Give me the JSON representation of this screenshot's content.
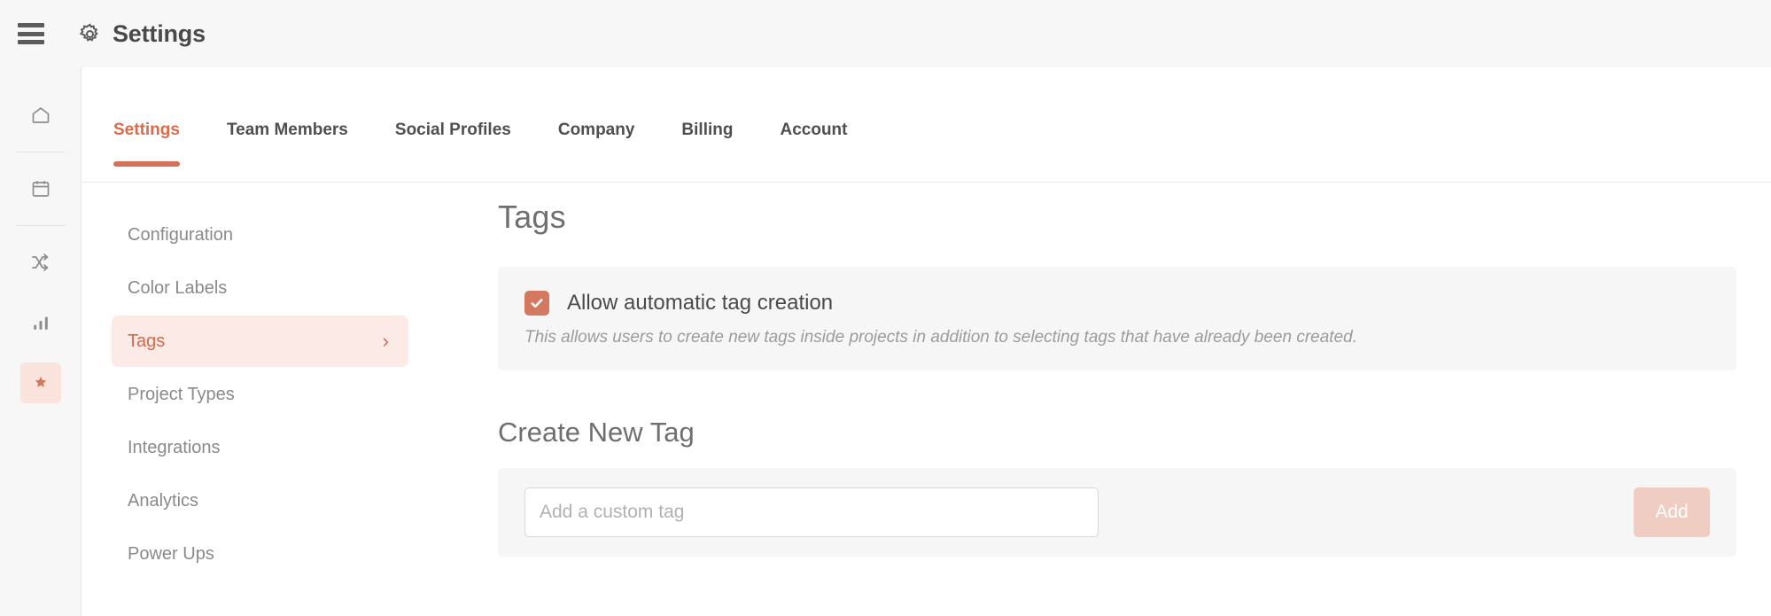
{
  "header": {
    "menu_icon": "hamburger-icon",
    "gear_icon": "gear-icon",
    "title": "Settings"
  },
  "rail": {
    "items": [
      {
        "icon": "home-icon",
        "highlight": false
      },
      {
        "icon": "calendar-icon",
        "highlight": false
      },
      {
        "icon": "shuffle-icon",
        "highlight": false
      },
      {
        "icon": "bar-chart-icon",
        "highlight": false
      },
      {
        "icon": "star-bookmark-icon",
        "highlight": true
      }
    ]
  },
  "tabs": [
    {
      "label": "Settings",
      "active": true
    },
    {
      "label": "Team Members",
      "active": false
    },
    {
      "label": "Social Profiles",
      "active": false
    },
    {
      "label": "Company",
      "active": false
    },
    {
      "label": "Billing",
      "active": false
    },
    {
      "label": "Account",
      "active": false
    }
  ],
  "submenu": [
    {
      "label": "Configuration",
      "active": false
    },
    {
      "label": "Color Labels",
      "active": false
    },
    {
      "label": "Tags",
      "active": true,
      "chevron": "›"
    },
    {
      "label": "Project Types",
      "active": false
    },
    {
      "label": "Integrations",
      "active": false
    },
    {
      "label": "Analytics",
      "active": false
    },
    {
      "label": "Power Ups",
      "active": false
    }
  ],
  "main": {
    "title": "Tags",
    "auto_tag": {
      "checked": true,
      "label": "Allow automatic tag creation",
      "description": "This allows users to create new tags inside projects in addition to selecting tags that have already been created."
    },
    "create_tag": {
      "title": "Create New Tag",
      "input_value": "",
      "input_placeholder": "Add a custom tag",
      "add_label": "Add"
    }
  },
  "colors": {
    "accent": "#d5705a",
    "accent_text": "#cf6a4d",
    "accent_soft": "#fbeae5",
    "checkbox": "#d4795f",
    "add_button": "#efcdc3",
    "panel_bg": "#f6f6f6",
    "chrome_bg": "#f7f7f7"
  }
}
